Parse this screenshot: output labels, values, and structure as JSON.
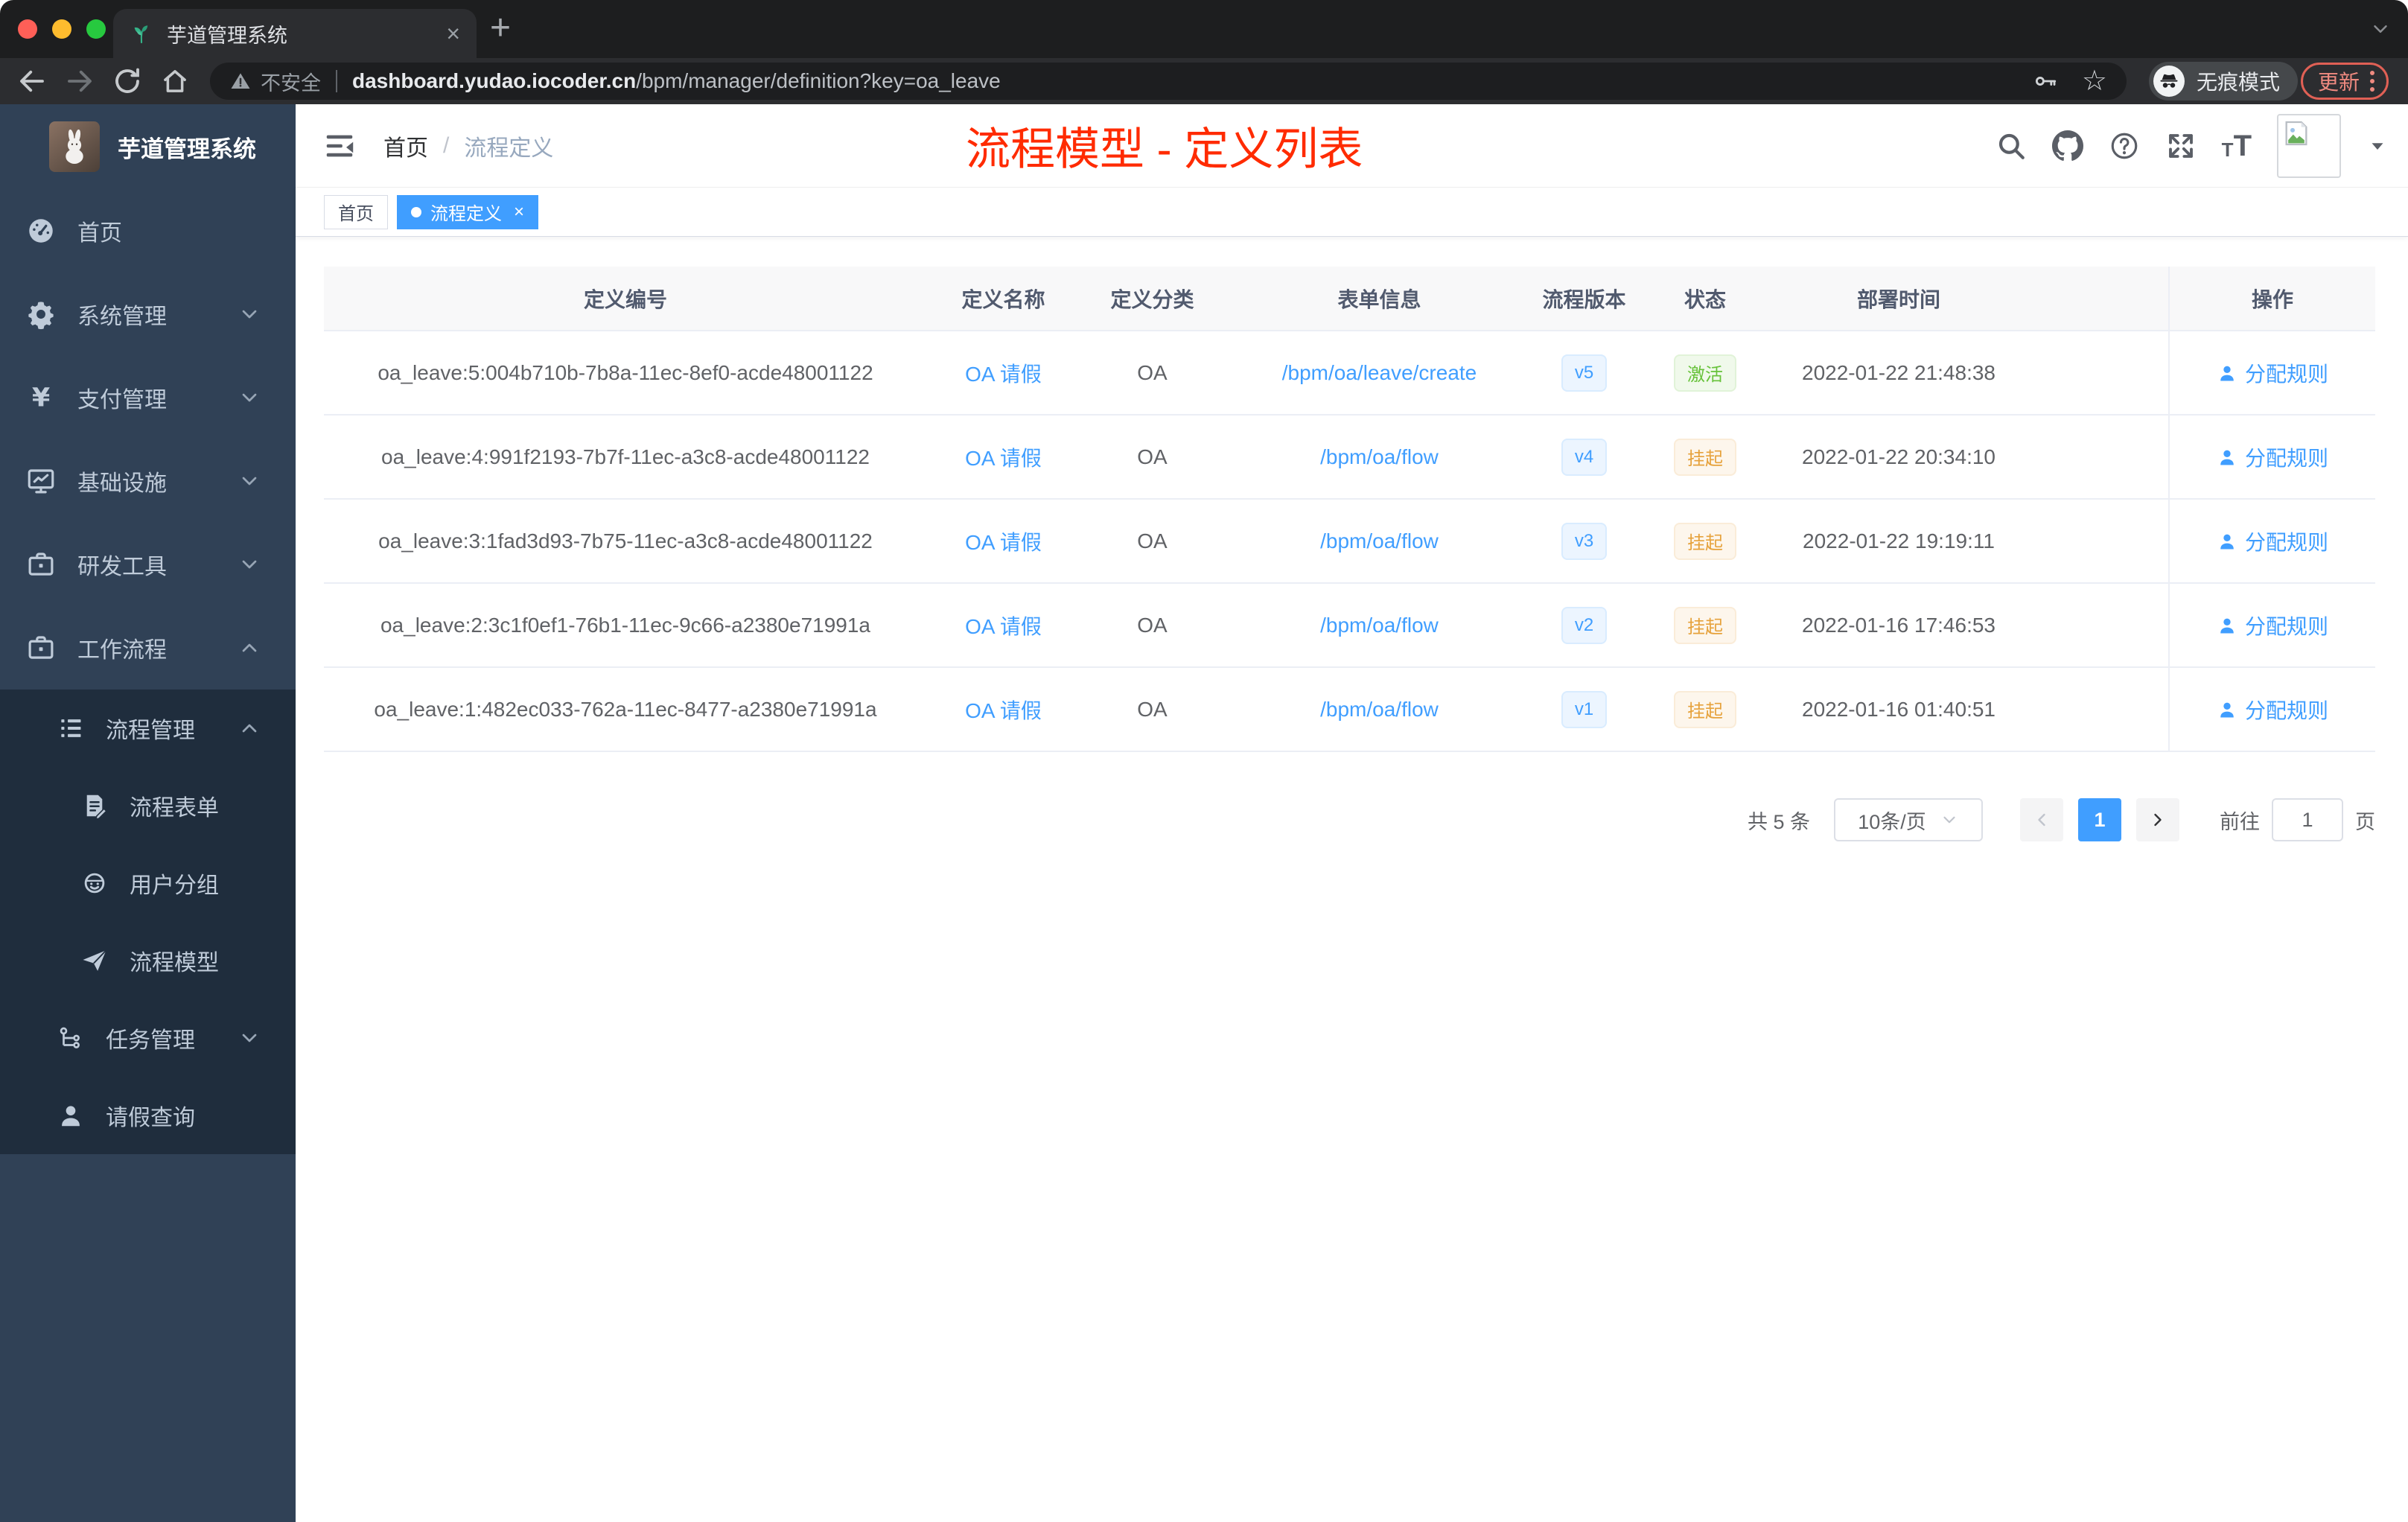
{
  "browser": {
    "tab_title": "芋道管理系统",
    "security_label": "不安全",
    "url_domain": "dashboard.yudao.iocoder.cn",
    "url_path": "/bpm/manager/definition?key=oa_leave",
    "incognito_label": "无痕模式",
    "update_label": "更新"
  },
  "colors": {
    "accent": "#409eff",
    "annotation_red": "#ff2b00",
    "success_green": "#67c23a",
    "warning_orange": "#e6a23c",
    "sidebar_bg": "#304156",
    "sidebar_submenu_bg": "#1f2d3d"
  },
  "sidebar": {
    "logo_title": "芋道管理系统",
    "items": [
      {
        "label": "首页",
        "icon": "dashboard",
        "level": 1,
        "in_submenu": false,
        "expand": "none"
      },
      {
        "label": "系统管理",
        "icon": "gear",
        "level": 1,
        "in_submenu": false,
        "expand": "collapsed"
      },
      {
        "label": "支付管理",
        "icon": "yen",
        "level": 1,
        "in_submenu": false,
        "expand": "collapsed"
      },
      {
        "label": "基础设施",
        "icon": "monitor",
        "level": 1,
        "in_submenu": false,
        "expand": "collapsed"
      },
      {
        "label": "研发工具",
        "icon": "toolbox",
        "level": 1,
        "in_submenu": false,
        "expand": "collapsed"
      },
      {
        "label": "工作流程",
        "icon": "toolbox",
        "level": 1,
        "in_submenu": false,
        "expand": "expanded"
      },
      {
        "label": "流程管理",
        "icon": "listtree",
        "level": 2,
        "in_submenu": true,
        "expand": "expanded"
      },
      {
        "label": "流程表单",
        "icon": "formdoc",
        "level": 3,
        "in_submenu": true,
        "expand": "none"
      },
      {
        "label": "用户分组",
        "icon": "robot",
        "level": 3,
        "in_submenu": true,
        "expand": "none"
      },
      {
        "label": "流程模型",
        "icon": "plane",
        "level": 3,
        "in_submenu": true,
        "expand": "none"
      },
      {
        "label": "任务管理",
        "icon": "orgtree",
        "level": 2,
        "in_submenu": true,
        "expand": "collapsed"
      },
      {
        "label": "请假查询",
        "icon": "user",
        "level": 2,
        "in_submenu": true,
        "expand": "none"
      }
    ]
  },
  "navbar": {
    "breadcrumb_home": "首页",
    "breadcrumb_sep": "/",
    "breadcrumb_current": "流程定义",
    "annotation": "流程模型 - 定义列表"
  },
  "tags": [
    {
      "label": "首页",
      "active": false
    },
    {
      "label": "流程定义",
      "active": true,
      "close_glyph": "×"
    }
  ],
  "table": {
    "headers": {
      "id": "定义编号",
      "name": "定义名称",
      "category": "定义分类",
      "form": "表单信息",
      "version": "流程版本",
      "status": "状态",
      "deploy_time": "部署时间",
      "action": "操作"
    },
    "rows": [
      {
        "id": "oa_leave:5:004b710b-7b8a-11ec-8ef0-acde48001122",
        "name": "OA 请假",
        "category": "OA",
        "form": "/bpm/oa/leave/create",
        "version": "v5",
        "status": "激活",
        "status_type": "success",
        "deploy_time": "2022-01-22 21:48:38",
        "action": "分配规则"
      },
      {
        "id": "oa_leave:4:991f2193-7b7f-11ec-a3c8-acde48001122",
        "name": "OA 请假",
        "category": "OA",
        "form": "/bpm/oa/flow",
        "version": "v4",
        "status": "挂起",
        "status_type": "warning",
        "deploy_time": "2022-01-22 20:34:10",
        "action": "分配规则"
      },
      {
        "id": "oa_leave:3:1fad3d93-7b75-11ec-a3c8-acde48001122",
        "name": "OA 请假",
        "category": "OA",
        "form": "/bpm/oa/flow",
        "version": "v3",
        "status": "挂起",
        "status_type": "warning",
        "deploy_time": "2022-01-22 19:19:11",
        "action": "分配规则"
      },
      {
        "id": "oa_leave:2:3c1f0ef1-76b1-11ec-9c66-a2380e71991a",
        "name": "OA 请假",
        "category": "OA",
        "form": "/bpm/oa/flow",
        "version": "v2",
        "status": "挂起",
        "status_type": "warning",
        "deploy_time": "2022-01-16 17:46:53",
        "action": "分配规则"
      },
      {
        "id": "oa_leave:1:482ec033-762a-11ec-8477-a2380e71991a",
        "name": "OA 请假",
        "category": "OA",
        "form": "/bpm/oa/flow",
        "version": "v1",
        "status": "挂起",
        "status_type": "warning",
        "deploy_time": "2022-01-16 01:40:51",
        "action": "分配规则"
      }
    ]
  },
  "pagination": {
    "total": "共 5 条",
    "page_size": "10条/页",
    "current_page": "1",
    "goto_label": "前往",
    "goto_value": "1",
    "goto_unit": "页"
  }
}
